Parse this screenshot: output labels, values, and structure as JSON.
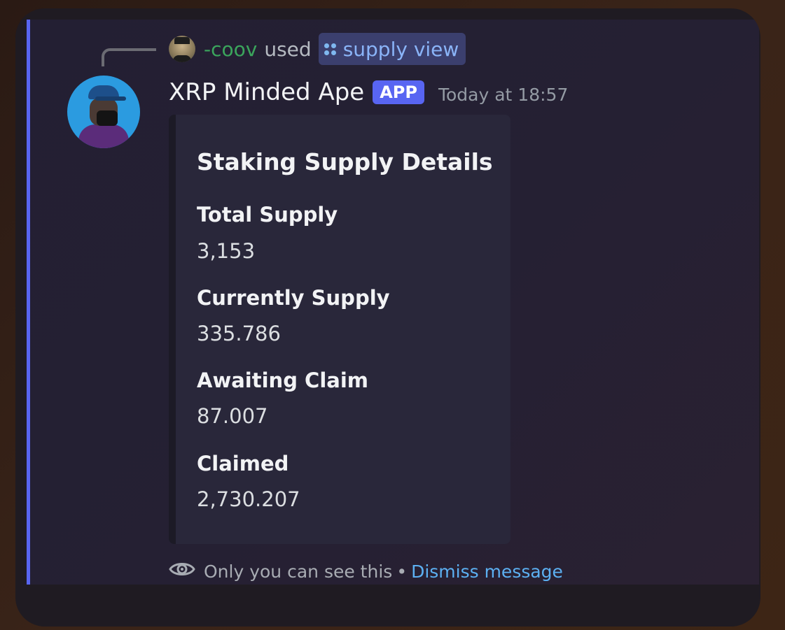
{
  "reference": {
    "username": "-coov",
    "used_text": "used",
    "command": "supply view"
  },
  "message": {
    "bot_name": "XRP Minded Ape",
    "badge": "APP",
    "timestamp": "Today at 18:57"
  },
  "embed": {
    "title": "Staking Supply Details",
    "fields": [
      {
        "name": "Total Supply",
        "value": "3,153"
      },
      {
        "name": "Currently Supply",
        "value": "335.786"
      },
      {
        "name": "Awaiting Claim",
        "value": "87.007"
      },
      {
        "name": "Claimed",
        "value": "2,730.207"
      }
    ]
  },
  "footer": {
    "visibility_text": "Only you can see this",
    "separator": "•",
    "dismiss_label": "Dismiss message"
  },
  "colors": {
    "accent": "#5865f2",
    "username": "#3ba55c",
    "link": "#5cb0f2"
  },
  "icons": [
    "eye-icon",
    "slash-command-icon"
  ]
}
